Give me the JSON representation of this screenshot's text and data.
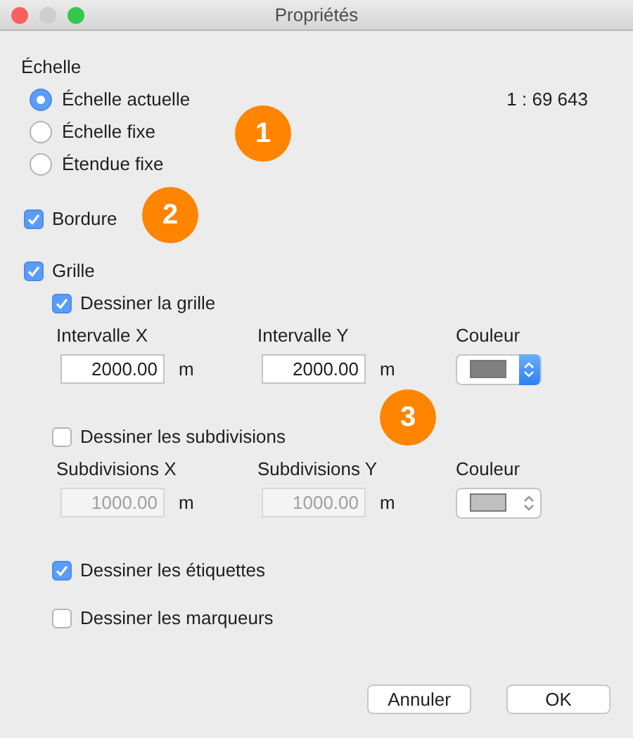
{
  "window": {
    "title": "Propriétés"
  },
  "scale": {
    "label": "Échelle",
    "value": "1 : 69 643",
    "options": [
      {
        "label": "Échelle actuelle",
        "selected": true
      },
      {
        "label": "Échelle fixe",
        "selected": false
      },
      {
        "label": "Étendue fixe",
        "selected": false
      }
    ]
  },
  "border": {
    "label": "Bordure",
    "checked": true
  },
  "grid": {
    "label": "Grille",
    "checked": true,
    "sections": [
      {
        "label": "Dessiner la grille",
        "checked": true,
        "fields": [
          {
            "label": "Intervalle X",
            "value": "2000.00",
            "unit": "m"
          },
          {
            "label": "Intervalle Y",
            "value": "2000.00",
            "unit": "m"
          }
        ],
        "color_label": "Couleur",
        "color": "#808080",
        "disabled": false
      },
      {
        "label": "Dessiner les subdivisions",
        "checked": false,
        "fields": [
          {
            "label": "Subdivisions X",
            "value": "1000.00",
            "unit": "m"
          },
          {
            "label": "Subdivisions Y",
            "value": "1000.00",
            "unit": "m"
          }
        ],
        "color_label": "Couleur",
        "color": "#bfbfbf",
        "disabled": true
      }
    ],
    "options": [
      {
        "label": "Dessiner les étiquettes",
        "checked": true
      },
      {
        "label": "Dessiner les marqueurs",
        "checked": false
      }
    ]
  },
  "callouts": [
    "1",
    "2",
    "3"
  ],
  "buttons": [
    "Annuler",
    "OK"
  ]
}
